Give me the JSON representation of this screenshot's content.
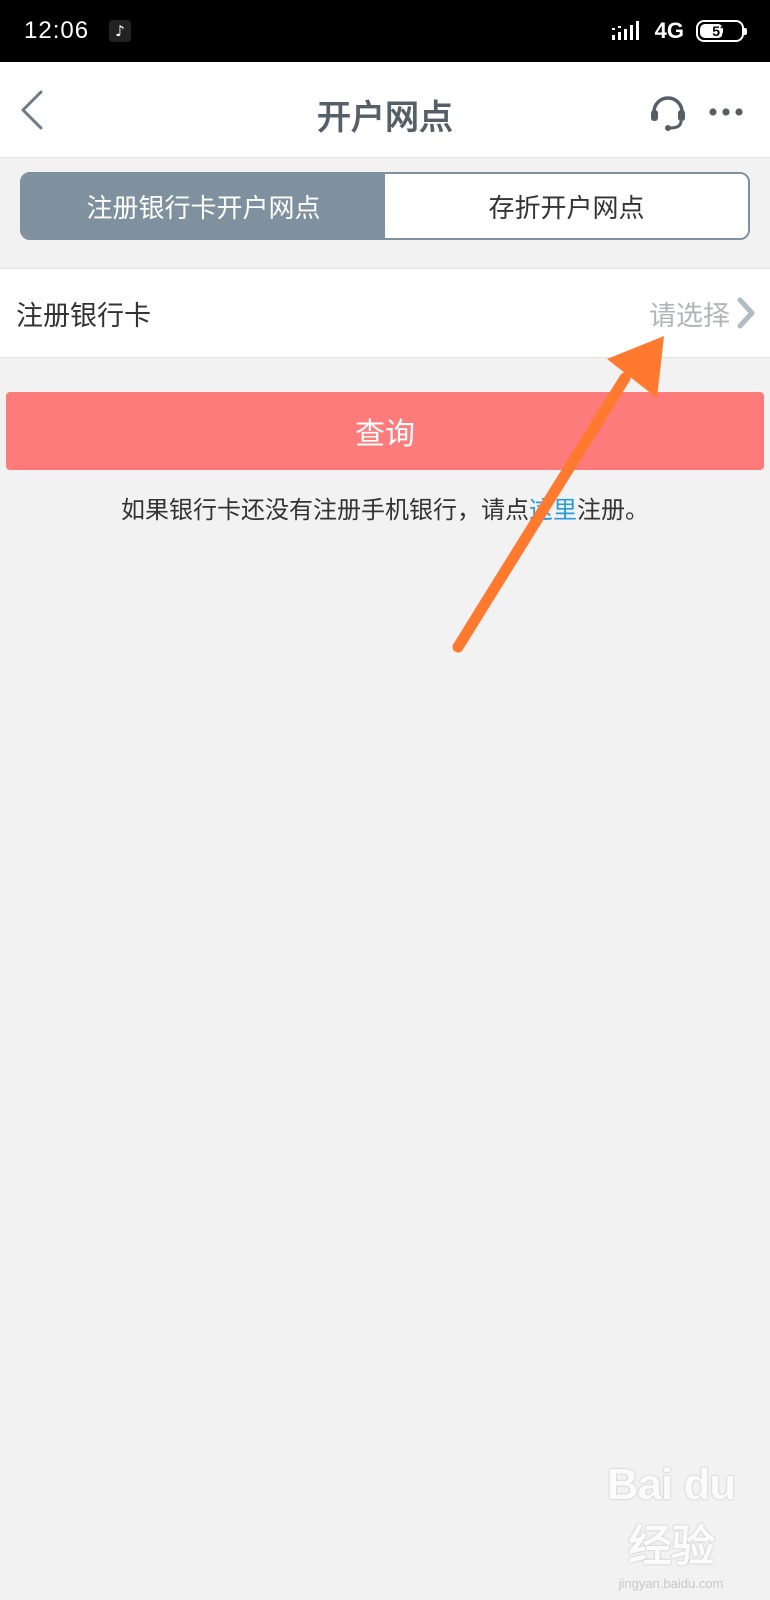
{
  "status_bar": {
    "time": "12:06",
    "app_icon": "tiktok-icon",
    "network": "4G",
    "battery": "57",
    "battery_level_percent": 57
  },
  "nav": {
    "title": "开户网点",
    "back_icon": "chevron-left-icon",
    "service_icon": "headset-icon",
    "more_icon": "more-dots-icon"
  },
  "tabs": [
    {
      "label": "注册银行卡开户网点",
      "active": true
    },
    {
      "label": "存折开户网点",
      "active": false
    }
  ],
  "select_row": {
    "label": "注册银行卡",
    "placeholder": "请选择"
  },
  "query_button": {
    "label": "查询"
  },
  "hint": {
    "prefix": "如果银行卡还没有注册手机银行，请点",
    "link": "这里",
    "suffix": "注册。"
  },
  "watermark": {
    "logo": "Bai du 经验",
    "sub": "jingyan.baidu.com"
  },
  "colors": {
    "tab_active": "#7f909e",
    "query_button": "#fe7b7b",
    "link": "#2a9bd8",
    "annotation_arrow": "#ff7a2e"
  }
}
